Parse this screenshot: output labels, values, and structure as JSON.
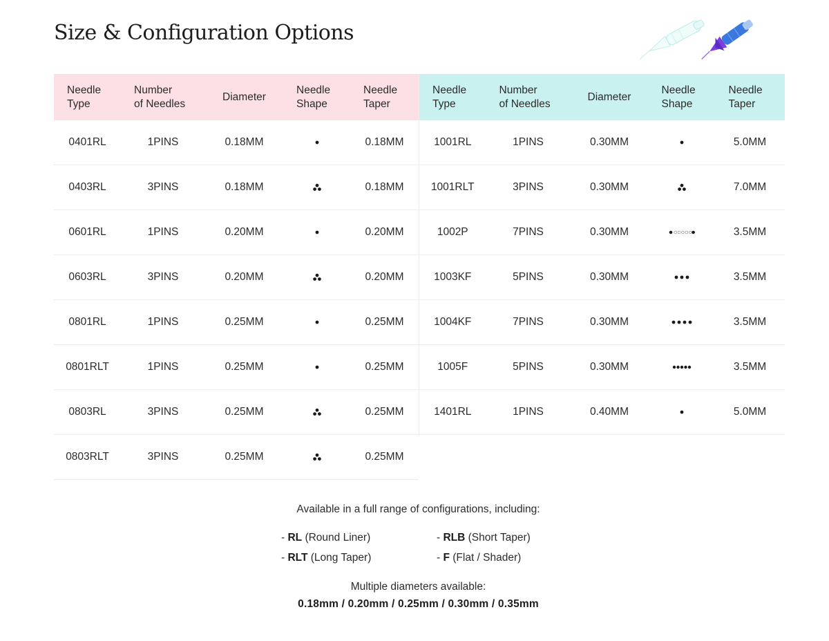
{
  "page": {
    "title": "Size & Configuration Options"
  },
  "headers": {
    "needle_type": [
      "Needle",
      "Type"
    ],
    "number_of_needles": [
      "Number",
      "of Needles"
    ],
    "diameter": "Diameter",
    "needle_shape": [
      "Needle",
      "Shape"
    ],
    "needle_taper": [
      "Needle",
      "Taper"
    ]
  },
  "left_table": {
    "rows": [
      {
        "type": "0401RL",
        "needles": "1PINS",
        "diameter": "0.18MM",
        "shape": "single-dot-icon",
        "taper": "0.18MM"
      },
      {
        "type": "0403RL",
        "needles": "3PINS",
        "diameter": "0.18MM",
        "shape": "three-dot-cluster-icon",
        "taper": "0.18MM"
      },
      {
        "type": "0601RL",
        "needles": "1PINS",
        "diameter": "0.20MM",
        "shape": "single-dot-icon",
        "taper": "0.20MM"
      },
      {
        "type": "0603RL",
        "needles": "3PINS",
        "diameter": "0.20MM",
        "shape": "three-dot-cluster-icon",
        "taper": "0.20MM"
      },
      {
        "type": "0801RL",
        "needles": "1PINS",
        "diameter": "0.25MM",
        "shape": "single-dot-icon",
        "taper": "0.25MM"
      },
      {
        "type": "0801RLT",
        "needles": "1PINS",
        "diameter": "0.25MM",
        "shape": "single-dot-icon",
        "taper": "0.25MM"
      },
      {
        "type": "0803RL",
        "needles": "3PINS",
        "diameter": "0.25MM",
        "shape": "three-dot-cluster-icon",
        "taper": "0.25MM"
      },
      {
        "type": "0803RLT",
        "needles": "3PINS",
        "diameter": "0.25MM",
        "shape": "three-dot-cluster-icon",
        "taper": "0.25MM"
      }
    ]
  },
  "right_table": {
    "rows": [
      {
        "type": "1001RL",
        "needles": "1PINS",
        "diameter": "0.30MM",
        "shape": "single-dot-icon",
        "taper": "5.0MM"
      },
      {
        "type": "1001RLT",
        "needles": "3PINS",
        "diameter": "0.30MM",
        "shape": "three-dot-cluster-icon",
        "taper": "7.0MM"
      },
      {
        "type": "1002P",
        "needles": "7PINS",
        "diameter": "0.30MM",
        "shape": "seven-dot-line-icon",
        "taper": "3.5MM"
      },
      {
        "type": "1003KF",
        "needles": "5PINS",
        "diameter": "0.30MM",
        "shape": "three-dot-row-icon",
        "taper": "3.5MM"
      },
      {
        "type": "1004KF",
        "needles": "7PINS",
        "diameter": "0.30MM",
        "shape": "four-dot-row-icon",
        "taper": "3.5MM"
      },
      {
        "type": "1005F",
        "needles": "5PINS",
        "diameter": "0.30MM",
        "shape": "five-dot-row-icon",
        "taper": "3.5MM"
      },
      {
        "type": "1401RL",
        "needles": "1PINS",
        "diameter": "0.40MM",
        "shape": "single-dot-icon",
        "taper": "5.0MM"
      }
    ]
  },
  "notes": {
    "available_text": "Available in a full range of configurations, including:",
    "configs": [
      {
        "code": "RL",
        "desc": "(Round Liner)"
      },
      {
        "code": "RLB",
        "desc": "(Short Taper)"
      },
      {
        "code": "RLT",
        "desc": "(Long Taper)"
      },
      {
        "code": "F",
        "desc": "(Flat / Shader)"
      }
    ],
    "multiple_text": "Multiple diameters available:",
    "diameters_text": "0.18mm / 0.20mm / 0.25mm / 0.30mm / 0.35mm"
  },
  "colors": {
    "left_header_bg": "#fde0e6",
    "right_header_bg": "#c9f1f0"
  }
}
